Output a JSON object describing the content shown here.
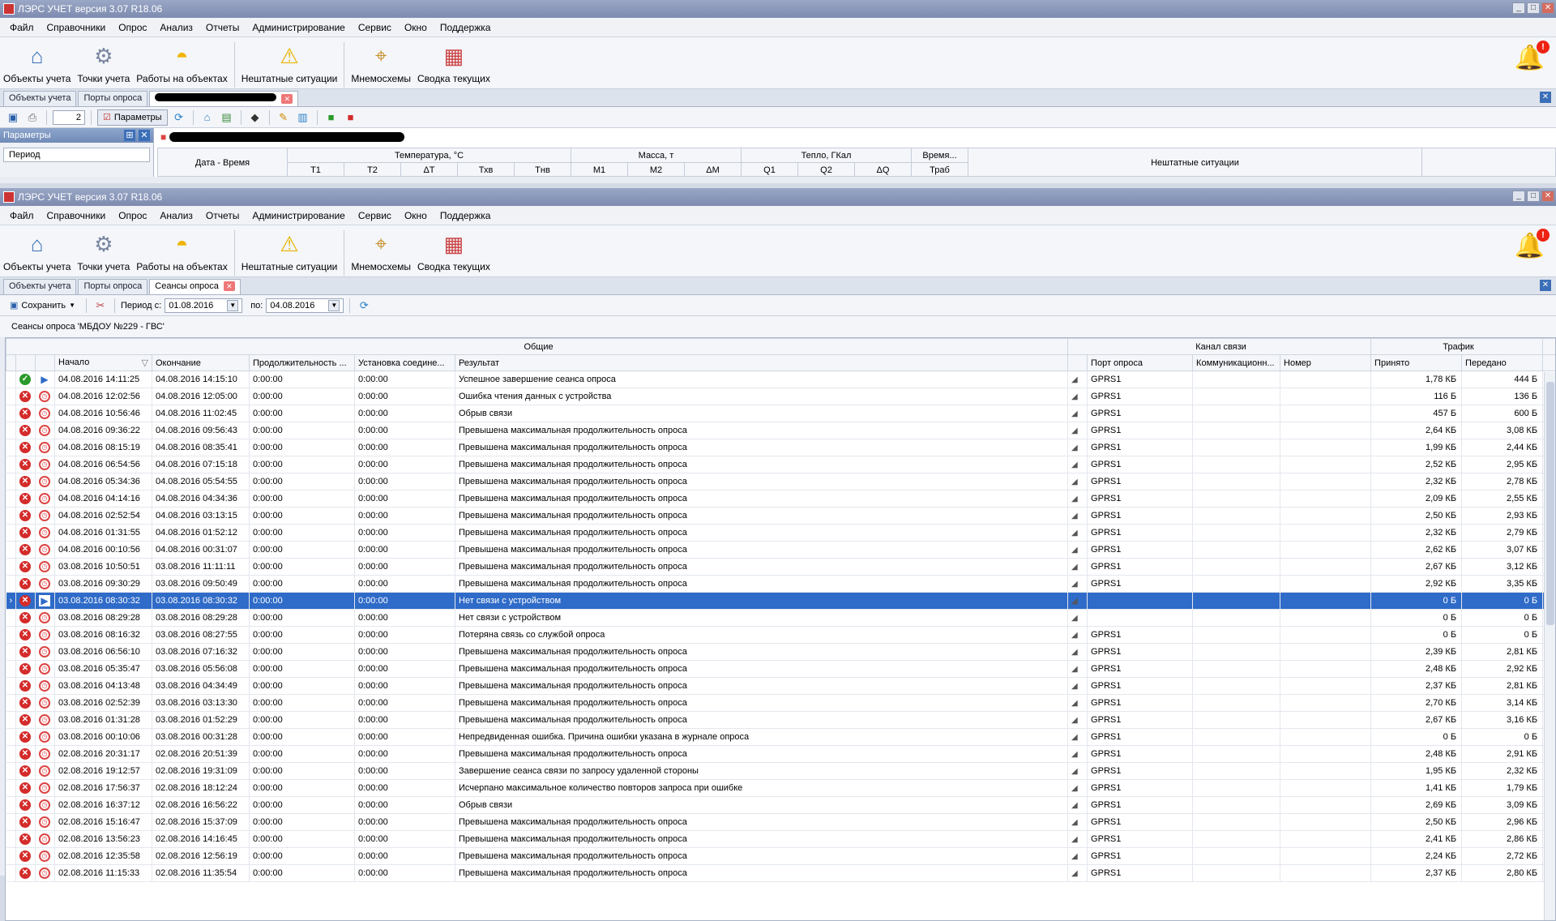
{
  "app": {
    "title": "ЛЭРС УЧЕТ версия 3.07 R18.06"
  },
  "window_controls": {
    "minimize": "_",
    "maximize": "□",
    "close": "✕"
  },
  "menu": [
    "Файл",
    "Справочники",
    "Опрос",
    "Анализ",
    "Отчеты",
    "Администрирование",
    "Сервис",
    "Окно",
    "Поддержка"
  ],
  "ribbon": [
    {
      "label": "Объекты учета",
      "icon": "house-icon"
    },
    {
      "label": "Точки учета",
      "icon": "meter-icon"
    },
    {
      "label": "Работы на объектах",
      "icon": "hardhat-icon"
    },
    {
      "label": "Нештатные ситуации",
      "icon": "warning-icon"
    },
    {
      "label": "Мнемосхемы",
      "icon": "map-pin-icon"
    },
    {
      "label": "Сводка текущих",
      "icon": "grid-table-icon"
    }
  ],
  "notifications": {
    "badge": "!"
  },
  "win1": {
    "tabs": [
      "Объекты учета",
      "Порты опроса"
    ],
    "toolbar": {
      "page": "2",
      "params_button": "Параметры"
    },
    "params_panel": {
      "title": "Параметры",
      "period_label": "Период"
    },
    "headers": {
      "datetime": "Дата - Время",
      "temp": "Температура, °С",
      "mass": "Масса, т",
      "heat": "Тепло, ГКал",
      "time": "Время...",
      "alarms": "Нештатные ситуации",
      "sub": [
        "Т1",
        "Т2",
        "ΔТ",
        "Тхв",
        "Тнв",
        "М1",
        "М2",
        "ΔМ",
        "Q1",
        "Q2",
        "ΔQ",
        "Траб"
      ]
    }
  },
  "win2": {
    "tabs": [
      "Объекты учета",
      "Порты опроса",
      "Сеансы опроса"
    ],
    "toolbar": {
      "save": "Сохранить",
      "period_from_label": "Период с:",
      "date_from": "01.08.2016",
      "to_label": "по:",
      "date_to": "04.08.2016"
    },
    "caption": "Сеансы опроса 'МБДОУ №229 - ГВС'",
    "groups": {
      "general": "Общие",
      "channel": "Канал связи",
      "traffic": "Трафик"
    },
    "columns": {
      "start": "Начало",
      "end": "Окончание",
      "duration": "Продолжительность ...",
      "connect": "Установка соедине...",
      "result": "Результат",
      "port": "Порт опроса",
      "comm": "Коммуникационн...",
      "number": "Номер",
      "received": "Принято",
      "sent": "Передано"
    },
    "rows": [
      {
        "status": "ok",
        "type": "play",
        "start": "04.08.2016 14:11:25",
        "end": "04.08.2016 14:15:10",
        "dur": "0:00:00",
        "conn": "0:00:00",
        "result": "Успешное завершение сеанса опроса",
        "port": "GPRS1",
        "recv": "1,78 КБ",
        "sent": "444 Б"
      },
      {
        "status": "err",
        "type": "clock",
        "start": "04.08.2016 12:02:56",
        "end": "04.08.2016 12:05:00",
        "dur": "0:00:00",
        "conn": "0:00:00",
        "result": "Ошибка чтения данных с устройства",
        "port": "GPRS1",
        "recv": "116 Б",
        "sent": "136 Б"
      },
      {
        "status": "err",
        "type": "clock",
        "start": "04.08.2016 10:56:46",
        "end": "04.08.2016 11:02:45",
        "dur": "0:00:00",
        "conn": "0:00:00",
        "result": "Обрыв связи",
        "port": "GPRS1",
        "recv": "457 Б",
        "sent": "600 Б"
      },
      {
        "status": "err",
        "type": "clock",
        "start": "04.08.2016 09:36:22",
        "end": "04.08.2016 09:56:43",
        "dur": "0:00:00",
        "conn": "0:00:00",
        "result": "Превышена максимальная продолжительность опроса",
        "port": "GPRS1",
        "recv": "2,64 КБ",
        "sent": "3,08 КБ"
      },
      {
        "status": "err",
        "type": "clock",
        "start": "04.08.2016 08:15:19",
        "end": "04.08.2016 08:35:41",
        "dur": "0:00:00",
        "conn": "0:00:00",
        "result": "Превышена максимальная продолжительность опроса",
        "port": "GPRS1",
        "recv": "1,99 КБ",
        "sent": "2,44 КБ"
      },
      {
        "status": "err",
        "type": "clock",
        "start": "04.08.2016 06:54:56",
        "end": "04.08.2016 07:15:18",
        "dur": "0:00:00",
        "conn": "0:00:00",
        "result": "Превышена максимальная продолжительность опроса",
        "port": "GPRS1",
        "recv": "2,52 КБ",
        "sent": "2,95 КБ"
      },
      {
        "status": "err",
        "type": "clock",
        "start": "04.08.2016 05:34:36",
        "end": "04.08.2016 05:54:55",
        "dur": "0:00:00",
        "conn": "0:00:00",
        "result": "Превышена максимальная продолжительность опроса",
        "port": "GPRS1",
        "recv": "2,32 КБ",
        "sent": "2,78 КБ"
      },
      {
        "status": "err",
        "type": "clock",
        "start": "04.08.2016 04:14:16",
        "end": "04.08.2016 04:34:36",
        "dur": "0:00:00",
        "conn": "0:00:00",
        "result": "Превышена максимальная продолжительность опроса",
        "port": "GPRS1",
        "recv": "2,09 КБ",
        "sent": "2,55 КБ"
      },
      {
        "status": "err",
        "type": "clock",
        "start": "04.08.2016 02:52:54",
        "end": "04.08.2016 03:13:15",
        "dur": "0:00:00",
        "conn": "0:00:00",
        "result": "Превышена максимальная продолжительность опроса",
        "port": "GPRS1",
        "recv": "2,50 КБ",
        "sent": "2,93 КБ"
      },
      {
        "status": "err",
        "type": "clock",
        "start": "04.08.2016 01:31:55",
        "end": "04.08.2016 01:52:12",
        "dur": "0:00:00",
        "conn": "0:00:00",
        "result": "Превышена максимальная продолжительность опроса",
        "port": "GPRS1",
        "recv": "2,32 КБ",
        "sent": "2,79 КБ"
      },
      {
        "status": "err",
        "type": "clock",
        "start": "04.08.2016 00:10:56",
        "end": "04.08.2016 00:31:07",
        "dur": "0:00:00",
        "conn": "0:00:00",
        "result": "Превышена максимальная продолжительность опроса",
        "port": "GPRS1",
        "recv": "2,62 КБ",
        "sent": "3,07 КБ"
      },
      {
        "status": "err",
        "type": "clock",
        "start": "03.08.2016 10:50:51",
        "end": "03.08.2016 11:11:11",
        "dur": "0:00:00",
        "conn": "0:00:00",
        "result": "Превышена максимальная продолжительность опроса",
        "port": "GPRS1",
        "recv": "2,67 КБ",
        "sent": "3,12 КБ"
      },
      {
        "status": "err",
        "type": "clock",
        "start": "03.08.2016 09:30:29",
        "end": "03.08.2016 09:50:49",
        "dur": "0:00:00",
        "conn": "0:00:00",
        "result": "Превышена максимальная продолжительность опроса",
        "port": "GPRS1",
        "recv": "2,92 КБ",
        "sent": "3,35 КБ"
      },
      {
        "status": "err",
        "type": "play",
        "selected": true,
        "start": "03.08.2016 08:30:32",
        "end": "03.08.2016 08:30:32",
        "dur": "0:00:00",
        "conn": "0:00:00",
        "result": "Нет связи с устройством",
        "port": "",
        "recv": "0 Б",
        "sent": "0 Б"
      },
      {
        "status": "err",
        "type": "clock",
        "start": "03.08.2016 08:29:28",
        "end": "03.08.2016 08:29:28",
        "dur": "0:00:00",
        "conn": "0:00:00",
        "result": "Нет связи с устройством",
        "port": "",
        "recv": "0 Б",
        "sent": "0 Б"
      },
      {
        "status": "err",
        "type": "clock",
        "start": "03.08.2016 08:16:32",
        "end": "03.08.2016 08:27:55",
        "dur": "0:00:00",
        "conn": "0:00:00",
        "result": "Потеряна связь со службой опроса",
        "port": "GPRS1",
        "recv": "0 Б",
        "sent": "0 Б"
      },
      {
        "status": "err",
        "type": "clock",
        "start": "03.08.2016 06:56:10",
        "end": "03.08.2016 07:16:32",
        "dur": "0:00:00",
        "conn": "0:00:00",
        "result": "Превышена максимальная продолжительность опроса",
        "port": "GPRS1",
        "recv": "2,39 КБ",
        "sent": "2,81 КБ"
      },
      {
        "status": "err",
        "type": "clock",
        "start": "03.08.2016 05:35:47",
        "end": "03.08.2016 05:56:08",
        "dur": "0:00:00",
        "conn": "0:00:00",
        "result": "Превышена максимальная продолжительность опроса",
        "port": "GPRS1",
        "recv": "2,48 КБ",
        "sent": "2,92 КБ"
      },
      {
        "status": "err",
        "type": "clock",
        "start": "03.08.2016 04:13:48",
        "end": "03.08.2016 04:34:49",
        "dur": "0:00:00",
        "conn": "0:00:00",
        "result": "Превышена максимальная продолжительность опроса",
        "port": "GPRS1",
        "recv": "2,37 КБ",
        "sent": "2,81 КБ"
      },
      {
        "status": "err",
        "type": "clock",
        "start": "03.08.2016 02:52:39",
        "end": "03.08.2016 03:13:30",
        "dur": "0:00:00",
        "conn": "0:00:00",
        "result": "Превышена максимальная продолжительность опроса",
        "port": "GPRS1",
        "recv": "2,70 КБ",
        "sent": "3,14 КБ"
      },
      {
        "status": "err",
        "type": "clock",
        "start": "03.08.2016 01:31:28",
        "end": "03.08.2016 01:52:29",
        "dur": "0:00:00",
        "conn": "0:00:00",
        "result": "Превышена максимальная продолжительность опроса",
        "port": "GPRS1",
        "recv": "2,67 КБ",
        "sent": "3,16 КБ"
      },
      {
        "status": "err",
        "type": "clock",
        "start": "03.08.2016 00:10:06",
        "end": "03.08.2016 00:31:28",
        "dur": "0:00:00",
        "conn": "0:00:00",
        "result": "Непредвиденная ошибка. Причина ошибки указана в журнале опроса",
        "port": "GPRS1",
        "recv": "0 Б",
        "sent": "0 Б"
      },
      {
        "status": "err",
        "type": "clock",
        "start": "02.08.2016 20:31:17",
        "end": "02.08.2016 20:51:39",
        "dur": "0:00:00",
        "conn": "0:00:00",
        "result": "Превышена максимальная продолжительность опроса",
        "port": "GPRS1",
        "recv": "2,48 КБ",
        "sent": "2,91 КБ"
      },
      {
        "status": "err",
        "type": "clock",
        "start": "02.08.2016 19:12:57",
        "end": "02.08.2016 19:31:09",
        "dur": "0:00:00",
        "conn": "0:00:00",
        "result": "Завершение сеанса связи по запросу удаленной стороны",
        "port": "GPRS1",
        "recv": "1,95 КБ",
        "sent": "2,32 КБ"
      },
      {
        "status": "err",
        "type": "clock",
        "start": "02.08.2016 17:56:37",
        "end": "02.08.2016 18:12:24",
        "dur": "0:00:00",
        "conn": "0:00:00",
        "result": "Исчерпано максимальное количество повторов запроса при ошибке",
        "port": "GPRS1",
        "recv": "1,41 КБ",
        "sent": "1,79 КБ"
      },
      {
        "status": "err",
        "type": "clock",
        "start": "02.08.2016 16:37:12",
        "end": "02.08.2016 16:56:22",
        "dur": "0:00:00",
        "conn": "0:00:00",
        "result": "Обрыв связи",
        "port": "GPRS1",
        "recv": "2,69 КБ",
        "sent": "3,09 КБ"
      },
      {
        "status": "err",
        "type": "clock",
        "start": "02.08.2016 15:16:47",
        "end": "02.08.2016 15:37:09",
        "dur": "0:00:00",
        "conn": "0:00:00",
        "result": "Превышена максимальная продолжительность опроса",
        "port": "GPRS1",
        "recv": "2,50 КБ",
        "sent": "2,96 КБ"
      },
      {
        "status": "err",
        "type": "clock",
        "start": "02.08.2016 13:56:23",
        "end": "02.08.2016 14:16:45",
        "dur": "0:00:00",
        "conn": "0:00:00",
        "result": "Превышена максимальная продолжительность опроса",
        "port": "GPRS1",
        "recv": "2,41 КБ",
        "sent": "2,86 КБ"
      },
      {
        "status": "err",
        "type": "clock",
        "start": "02.08.2016 12:35:58",
        "end": "02.08.2016 12:56:19",
        "dur": "0:00:00",
        "conn": "0:00:00",
        "result": "Превышена максимальная продолжительность опроса",
        "port": "GPRS1",
        "recv": "2,24 КБ",
        "sent": "2,72 КБ"
      },
      {
        "status": "err",
        "type": "clock",
        "start": "02.08.2016 11:15:33",
        "end": "02.08.2016 11:35:54",
        "dur": "0:00:00",
        "conn": "0:00:00",
        "result": "Превышена максимальная продолжительность опроса",
        "port": "GPRS1",
        "recv": "2,37 КБ",
        "sent": "2,80 КБ"
      }
    ]
  }
}
